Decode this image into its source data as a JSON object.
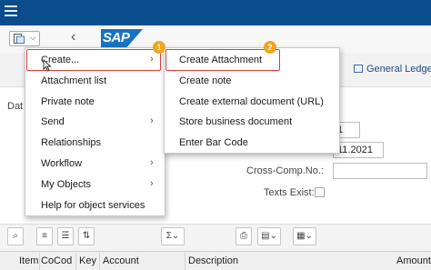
{
  "header": {
    "sap_logo": "SAP",
    "general_ledger_label": "General Ledger"
  },
  "form": {
    "dat_label": "Dat",
    "field1_value": "1",
    "field2_value": "11.2021",
    "cross_comp_label": "Cross-Comp.No.:",
    "texts_exist_label": "Texts Exist:"
  },
  "menu_main": {
    "items": [
      {
        "label": "Create...",
        "underline": "C",
        "has_submenu": true
      },
      {
        "label": "Attachment list",
        "underline": "A",
        "has_submenu": false
      },
      {
        "label": "Private note",
        "underline": "P",
        "has_submenu": false
      },
      {
        "label": "Send",
        "underline": "S",
        "has_submenu": true
      },
      {
        "label": "Relationships",
        "underline": "R",
        "has_submenu": false
      },
      {
        "label": "Workflow",
        "underline": "W",
        "has_submenu": true
      },
      {
        "label": "My Objects",
        "underline": "M",
        "has_submenu": true
      },
      {
        "label": "Help for object services",
        "underline": "H",
        "has_submenu": false
      }
    ],
    "submenu_arrow": "›"
  },
  "menu_sub": {
    "items": [
      {
        "label": "Create Attachment",
        "underline": "C"
      },
      {
        "label": "Create note",
        "underline": "C"
      },
      {
        "label": "Create external document (URL)",
        "underline": "C"
      },
      {
        "label": "Store business document",
        "underline": "S"
      },
      {
        "label": "Enter Bar Code",
        "underline": "E"
      }
    ]
  },
  "badges": {
    "step1": "1",
    "step2": "2"
  },
  "toolbar_icons": [
    "zoom-icon",
    "align-icon",
    "filter-icon",
    "sort-icon",
    "sum-icon",
    "print-icon",
    "export-icon",
    "layout-icon"
  ],
  "table": {
    "columns": [
      "Item",
      "CoCod",
      "Key",
      "Account",
      "Description",
      "Amount"
    ]
  },
  "colors": {
    "highlight": "#e03c3c",
    "badge": "#f3a41c",
    "titlebar": "#0a4d8c"
  }
}
